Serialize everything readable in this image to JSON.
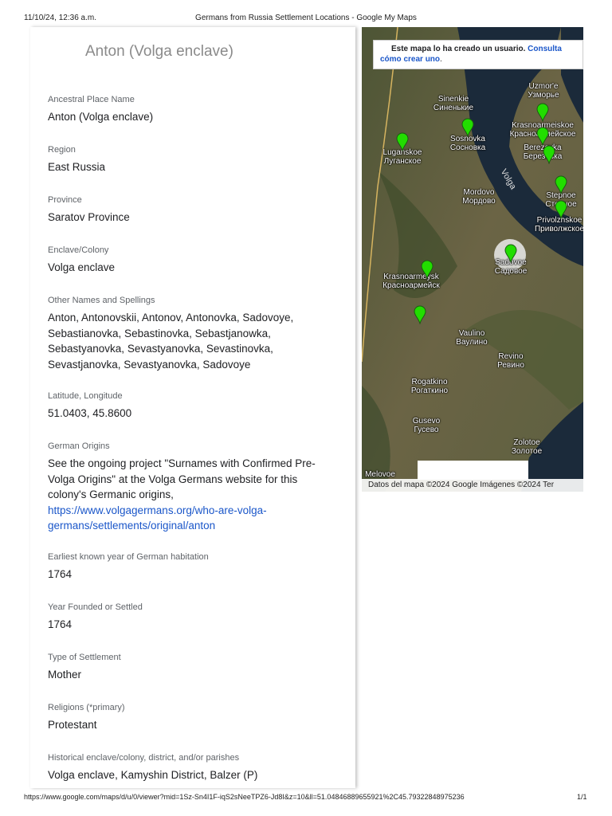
{
  "browser": {
    "datetime": "11/10/24, 12:36 a.m.",
    "page_title": "Germans from Russia Settlement Locations - Google My Maps",
    "url": "https://www.google.com/maps/d/u/0/viewer?mid=1Sz-Sn4I1F-iqS2sNeeTPZ6-Jd8I&z=10&ll=51.04846889655921%2C45.79322848975236",
    "page_count": "1/1"
  },
  "place": {
    "title": "Anton (Volga enclave)",
    "fields": [
      {
        "label": "Ancestral Place Name",
        "value": "Anton (Volga enclave)"
      },
      {
        "label": "Region",
        "value": "East Russia"
      },
      {
        "label": "Province",
        "value": "Saratov Province"
      },
      {
        "label": "Enclave/Colony",
        "value": "Volga enclave"
      },
      {
        "label": "Other Names and Spellings",
        "value": "Anton, Antonovskii, Antonov, Antonovka, Sadovoye, Sebastianovka, Sebastinovka, Sebastjanowka, Sebastyanovka, Sevastyanovka, Sevastinovka, Sevastjanovka, Sevastyanovka, Sadovoye"
      },
      {
        "label": "Latitude, Longitude",
        "value": "51.0403, 45.8600"
      },
      {
        "label": "German Origins",
        "value": "See the ongoing project \"Surnames with Confirmed Pre-Volga Origins\" at the Volga Germans website for this colony's Germanic origins,",
        "link": "https://www.volgagermans.org/who-are-volga-germans/settlements/original/anton"
      },
      {
        "label": "Earliest known year of German habitation",
        "value": "1764"
      },
      {
        "label": "Year Founded or Settled",
        "value": "1764"
      },
      {
        "label": "Type of Settlement",
        "value": "Mother"
      },
      {
        "label": "Religions (*primary)",
        "value": "Protestant"
      },
      {
        "label": "Historical enclave/colony, district, and/or parishes",
        "value": "Volga enclave, Kamyshin District, Balzer (P)"
      }
    ]
  },
  "map": {
    "notice_text": "Este mapa lo ha creado un usuario.",
    "notice_link": "Consulta cómo crear uno",
    "notice_end": ".",
    "river_label": "Volga",
    "attribution": "Datos del mapa ©2024 Google Imágenes ©2024 Ter",
    "places": [
      {
        "latin": "Uzmor'e",
        "cyrillic": "Узморье"
      },
      {
        "latin": "Sinenkie",
        "cyrillic": "Синенькие"
      },
      {
        "latin": "Krasnoarmeiskoe",
        "cyrillic": "Красноармейское"
      },
      {
        "latin": "Sosnovka",
        "cyrillic": "Сосновка"
      },
      {
        "latin": "Luganskoe",
        "cyrillic": "Луганское"
      },
      {
        "latin": "Berezovka",
        "cyrillic": "Березовка"
      },
      {
        "latin": "Mordovo",
        "cyrillic": "Мордово"
      },
      {
        "latin": "Stepnoe",
        "cyrillic": "Степное"
      },
      {
        "latin": "Privolzhskoe",
        "cyrillic": "Приволжское"
      },
      {
        "latin": "Sadovoe",
        "cyrillic": "Садовое"
      },
      {
        "latin": "Krasnoarmeysk",
        "cyrillic": "Красноармейск"
      },
      {
        "latin": "Vaulino",
        "cyrillic": "Ваулино"
      },
      {
        "latin": "Revino",
        "cyrillic": "Ревино"
      },
      {
        "latin": "Rogatkino",
        "cyrillic": "Рогаткино"
      },
      {
        "latin": "Gusevo",
        "cyrillic": "Гусево"
      },
      {
        "latin": "Zolotoe",
        "cyrillic": "Золотое"
      },
      {
        "latin": "Melovoe",
        "cyrillic": ""
      }
    ],
    "pin_color": "#22dd00"
  }
}
